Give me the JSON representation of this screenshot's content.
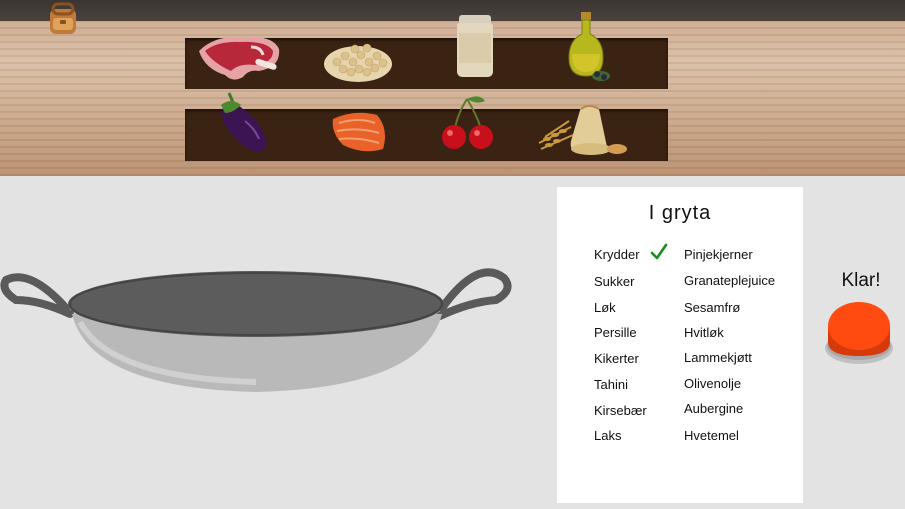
{
  "toolbar": {
    "backpack_icon": "backpack-icon"
  },
  "shelf": {
    "row1": [
      "lamb-meat",
      "chickpeas",
      "tahini-jar",
      "olive-oil"
    ],
    "row2": [
      "eggplant",
      "salmon",
      "cherries",
      "wheat-flour"
    ]
  },
  "pot": {
    "title": "I gryta",
    "col1": [
      {
        "label": "Krydder",
        "checked": true
      },
      {
        "label": "Sukker",
        "checked": false
      },
      {
        "label": "Løk",
        "checked": false
      },
      {
        "label": "Persille",
        "checked": false
      },
      {
        "label": "Kikerter",
        "checked": false
      },
      {
        "label": "Tahini",
        "checked": false
      },
      {
        "label": "Kirsebær",
        "checked": false
      },
      {
        "label": "Laks",
        "checked": false
      }
    ],
    "col2": [
      {
        "label": "Pinjekjerner"
      },
      {
        "label": "Granateplejuice"
      },
      {
        "label": "Sesamfrø"
      },
      {
        "label": "Hvitløk"
      },
      {
        "label": "Lammekjøtt"
      },
      {
        "label": "Olivenolje"
      },
      {
        "label": "Aubergine"
      },
      {
        "label": "Hvetemel"
      }
    ]
  },
  "done": {
    "label": "Klar!"
  },
  "colors": {
    "button": "#ff4a10",
    "check": "#1f8a1f",
    "shelf": "#3a2313"
  }
}
